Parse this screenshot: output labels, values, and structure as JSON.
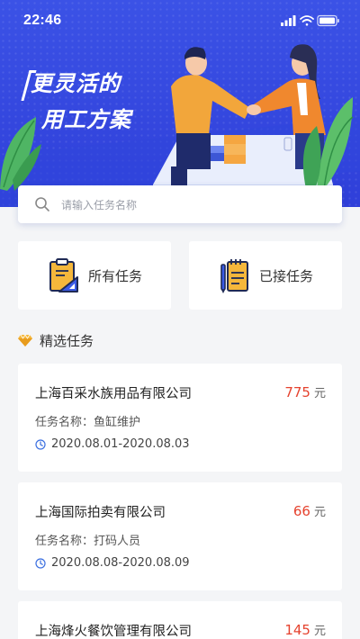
{
  "status_bar": {
    "time": "22:46"
  },
  "banner": {
    "slogan_line1": "更灵活的",
    "slogan_line2": "用工方案"
  },
  "search": {
    "placeholder": "请输入任务名称"
  },
  "quick_actions": [
    {
      "label": "所有任务",
      "icon": "clipboard-ruler-icon"
    },
    {
      "label": "已接任务",
      "icon": "notepad-pen-icon"
    }
  ],
  "section": {
    "title": "精选任务",
    "icon": "gem-icon"
  },
  "tasks": [
    {
      "company": "上海百采水族用品有限公司",
      "price": "775",
      "unit": "元",
      "task_name": "任务名称：鱼缸维护",
      "date_range": "2020.08.01-2020.08.03"
    },
    {
      "company": "上海国际拍卖有限公司",
      "price": "66",
      "unit": "元",
      "task_name": "任务名称：打码人员",
      "date_range": "2020.08.08-2020.08.09"
    },
    {
      "company": "上海烽火餐饮管理有限公司",
      "price": "145",
      "unit": "元"
    }
  ],
  "colors": {
    "brand_blue": "#3b52e6",
    "price_red": "#e5432f",
    "background": "#f4f5f7"
  }
}
